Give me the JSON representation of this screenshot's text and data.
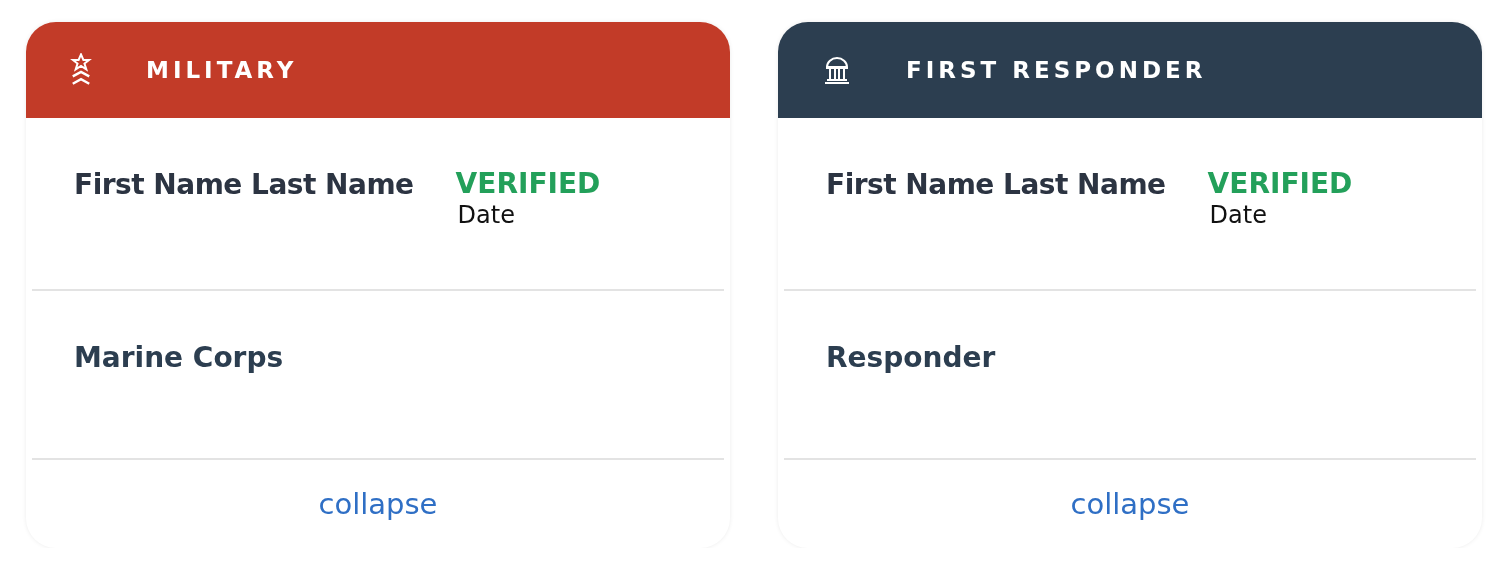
{
  "cards": [
    {
      "kind": "military",
      "color": "#c23b28",
      "title": "MILITARY",
      "name": "First Name Last Name",
      "status": "VERIFIED",
      "date": "Date",
      "category": "Marine Corps",
      "action": "collapse"
    },
    {
      "kind": "building",
      "color": "#2c3e50",
      "title": "FIRST RESPONDER",
      "name": "First Name Last Name",
      "status": "VERIFIED",
      "date": "Date",
      "category": "Responder",
      "action": "collapse"
    }
  ]
}
